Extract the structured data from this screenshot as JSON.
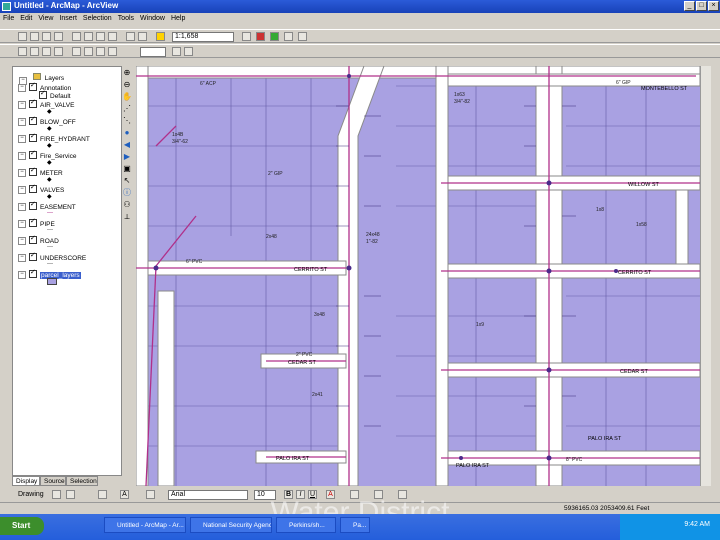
{
  "window": {
    "title": "Untitled - ArcMap - ArcView"
  },
  "menu": [
    "File",
    "Edit",
    "View",
    "Insert",
    "Selection",
    "Tools",
    "Window",
    "Help"
  ],
  "toolbar": {
    "scale": "1:1,658"
  },
  "toc": {
    "root": "Layers",
    "layers": [
      {
        "name": "Annotation",
        "sub": "Default"
      },
      {
        "name": "AIR_VALVE"
      },
      {
        "name": "BLOW_OFF"
      },
      {
        "name": "FIRE_HYDRANT"
      },
      {
        "name": "Fire_Service"
      },
      {
        "name": "METER"
      },
      {
        "name": "VALVES"
      },
      {
        "name": "EASEMENT"
      },
      {
        "name": "PIPE"
      },
      {
        "name": "ROAD"
      },
      {
        "name": "UNDERSCORE"
      },
      {
        "name": "parcel_layers"
      }
    ],
    "tabs": [
      "Display",
      "Source",
      "Selection"
    ]
  },
  "map": {
    "streets": [
      {
        "label": "CERRITO ST"
      },
      {
        "label": "CEDAR ST"
      },
      {
        "label": "PALO IRA ST"
      },
      {
        "label": "MONTEBELLO ST"
      },
      {
        "label": "WILLOW ST"
      },
      {
        "label": "CERRITO ST"
      },
      {
        "label": "CEDAR ST"
      },
      {
        "label": "PALO IRA ST"
      },
      {
        "label": "PALO IRA ST"
      }
    ],
    "pipe_labels": [
      "6\" ACP",
      "2\" GIP",
      "6\" PVC",
      "2\" PVC",
      "8\" PVC",
      "6\" GIP"
    ],
    "lot_labels": [
      "1x4B",
      "3/4\"-62",
      "2x48",
      "1x63",
      "3/4\"-82",
      "24x48",
      "1\"-82",
      "1x9",
      "1x8",
      "3x48",
      "2x41",
      "1x58"
    ]
  },
  "drawbar": {
    "drawing_label": "Drawing",
    "font": "Arial",
    "size": "10"
  },
  "status": {
    "coords": "5936165.03  2053409.61 Feet"
  },
  "taskbar": {
    "start": "Start",
    "tasks": [
      "Untitled - ArcMap - Ar...",
      "National Security Agency/...",
      "Perkins/sh...",
      "Pa..."
    ],
    "clock": "9:42 AM"
  },
  "overlay": "Water District",
  "colors": {
    "parcel_fill": "#a9a1e2",
    "road_fill": "#ffffff",
    "pipe": "#b0308a",
    "title_bar": "#1842b8"
  }
}
